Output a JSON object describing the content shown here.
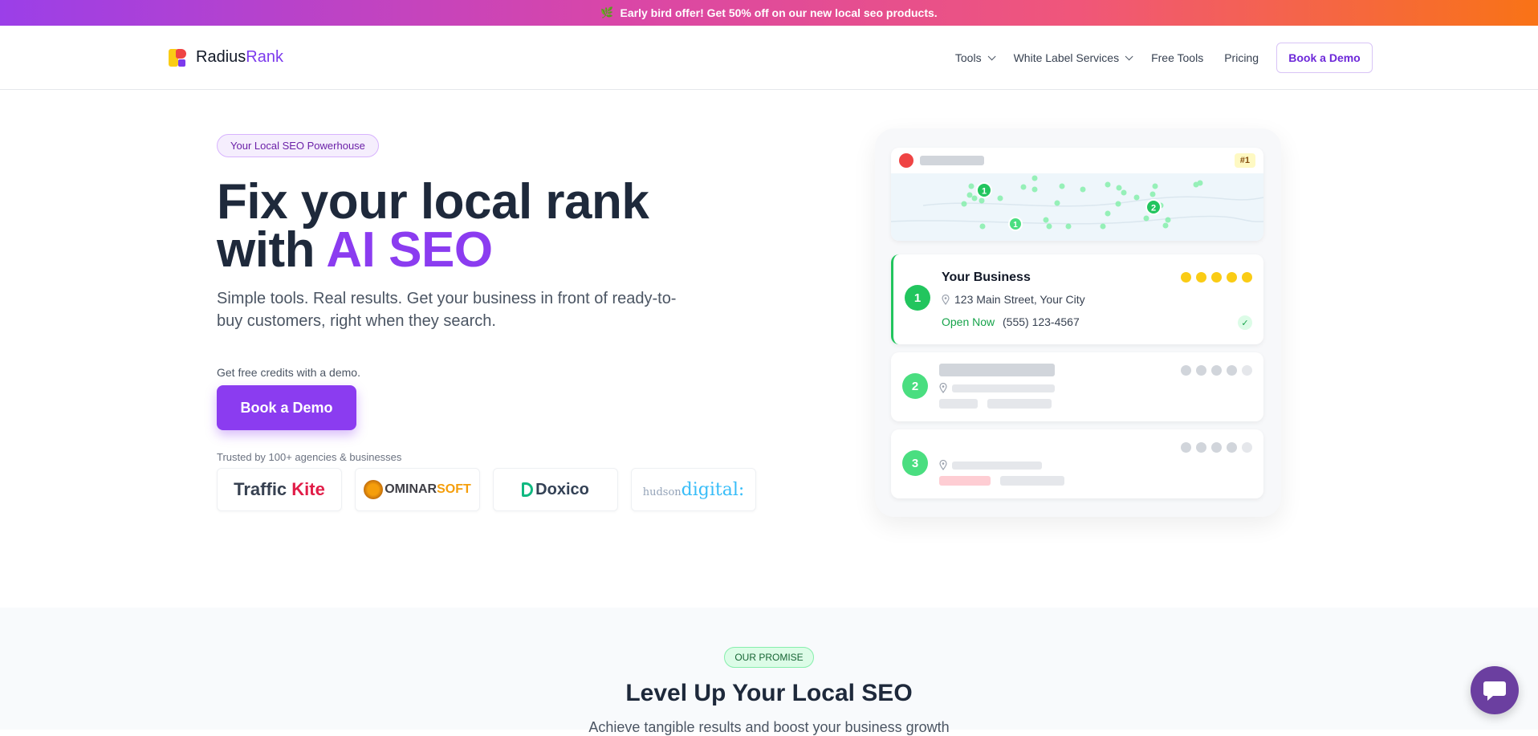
{
  "promo": {
    "icon": "leaf-icon",
    "text": "Early bird offer! Get 50% off on our new local seo products."
  },
  "brand": {
    "name_part1": "Radius",
    "name_part2": "Rank"
  },
  "nav": {
    "items": [
      {
        "label": "Tools",
        "dropdown": true
      },
      {
        "label": "White Label Services",
        "dropdown": true
      },
      {
        "label": "Free Tools",
        "dropdown": false
      },
      {
        "label": "Pricing",
        "dropdown": false
      }
    ],
    "cta": "Book a Demo"
  },
  "hero": {
    "badge": "Your Local SEO Powerhouse",
    "headline_line1": "Fix your local rank",
    "headline_with": "with ",
    "headline_accent": "AI SEO",
    "subtitle": "Simple tools. Real results. Get your business in front of ready-to-buy customers, right when they search.",
    "credits_note": "Get free credits with a demo.",
    "cta": "Book a Demo",
    "trusted": "Trusted by 100+ agencies & businesses",
    "partner_logos": [
      {
        "name": "Traffic Kite",
        "part1": "Traffic ",
        "part2": "Kite"
      },
      {
        "name": "DominarSoft",
        "part1": "OMINAR",
        "part2": "SOFT"
      },
      {
        "name": "Doxico",
        "text": "Doxico"
      },
      {
        "name": "hudson digital",
        "part1": "hudson",
        "part2": "digital:"
      }
    ]
  },
  "listing_preview": {
    "map_rank_badge": "#1",
    "map_pins": [
      "1",
      "2",
      "1"
    ],
    "results": [
      {
        "rank": "1",
        "name": "Your Business",
        "address": "123 Main Street, Your City",
        "status": "Open Now",
        "phone": "(555) 123-4567",
        "rating_stars": 5,
        "verified": true
      },
      {
        "rank": "2",
        "rating_stars": 4
      },
      {
        "rank": "3",
        "rating_stars": 4
      }
    ]
  },
  "promise": {
    "badge": "OUR PROMISE",
    "title": "Level Up Your Local SEO",
    "subtitle": "Achieve tangible results and boost your business growth"
  },
  "colors": {
    "brand_purple": "#8b3cf0",
    "success_green": "#22c55e",
    "star_yellow": "#facc15"
  },
  "chat": {
    "icon": "chat-bubble-icon"
  }
}
